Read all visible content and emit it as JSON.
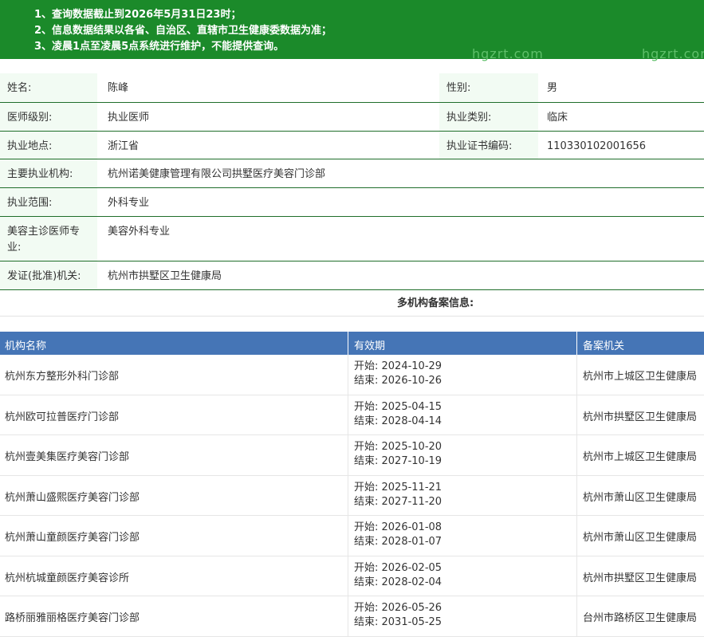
{
  "notice": {
    "lines": [
      "1、查询数据截止到2026年5月31日23时；",
      "2、信息数据结果以各省、自治区、直辖市卫生健康委数据为准；",
      "3、凌晨1点至凌晨5点系统进行维护，不能提供查询。"
    ],
    "watermark": "hgzrt.com"
  },
  "doctor": {
    "name_label": "姓名:",
    "name": "陈峰",
    "gender_label": "性别:",
    "gender": "男",
    "level_label": "医师级别:",
    "level": "执业医师",
    "category_label": "执业类别:",
    "category": "临床",
    "location_label": "执业地点:",
    "location": "浙江省",
    "cert_label": "执业证书编码:",
    "cert": "110330102001656",
    "org_label": "主要执业机构:",
    "org": "杭州诺美健康管理有限公司拱墅医疗美容门诊部",
    "scope_label": "执业范围:",
    "scope": "外科专业",
    "cosmetic_label": "美容主诊医师专业:",
    "cosmetic": "美容外科专业",
    "issuer_label": "发证(批准)机关:",
    "issuer": "杭州市拱墅区卫生健康局"
  },
  "multi": {
    "title": "多机构备案信息:",
    "headers": [
      "机构名称",
      "有效期",
      "备案机关"
    ],
    "rows": [
      {
        "name": "杭州东方整形外科门诊部",
        "start": "开始:  2024-10-29",
        "end": "结束:  2026-10-26",
        "authority": "杭州市上城区卫生健康局"
      },
      {
        "name": "杭州欧可拉普医疗门诊部",
        "start": "开始:  2025-04-15",
        "end": "结束:  2028-04-14",
        "authority": "杭州市拱墅区卫生健康局"
      },
      {
        "name": "杭州壹美集医疗美容门诊部",
        "start": "开始:  2025-10-20",
        "end": "结束:  2027-10-19",
        "authority": "杭州市上城区卫生健康局"
      },
      {
        "name": "杭州萧山盛熙医疗美容门诊部",
        "start": "开始:  2025-11-21",
        "end": "结束:  2027-11-20",
        "authority": "杭州市萧山区卫生健康局"
      },
      {
        "name": "杭州萧山童颜医疗美容门诊部",
        "start": "开始:  2026-01-08",
        "end": "结束:  2028-01-07",
        "authority": "杭州市萧山区卫生健康局"
      },
      {
        "name": "杭州杭城童颜医疗美容诊所",
        "start": "开始:  2026-02-05",
        "end": "结束:  2028-02-04",
        "authority": "杭州市拱墅区卫生健康局"
      },
      {
        "name": "路桥丽雅丽格医疗美容门诊部",
        "start": "开始:  2026-05-26",
        "end": "结束:  2031-05-25",
        "authority": "台州市路桥区卫生健康局"
      }
    ]
  }
}
